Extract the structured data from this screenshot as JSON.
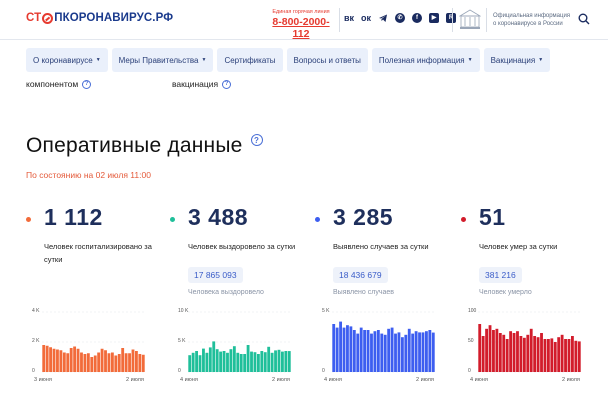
{
  "header": {
    "logo_part1": "СТ",
    "logo_part2": "ПКОРОНАВИРУС.РФ",
    "hotline_caption": "Единая горячая линия",
    "hotline_number": "8-800-2000-112",
    "socials": [
      "vk-icon",
      "ok-icon",
      "telegram-icon",
      "viber-icon",
      "fb-icon",
      "youtube-icon",
      "rutube-icon"
    ],
    "official_info": "Официальная информация о коронавирусе в России"
  },
  "nav": {
    "items": [
      {
        "label": "О коронавирусе",
        "dropdown": true
      },
      {
        "label": "Меры Правительства",
        "dropdown": true
      },
      {
        "label": "Сертификаты",
        "dropdown": false
      },
      {
        "label": "Вопросы и ответы",
        "dropdown": false
      },
      {
        "label": "Полезная информация",
        "dropdown": true
      },
      {
        "label": "Вакцинация",
        "dropdown": true
      }
    ]
  },
  "cut_text": {
    "left": "компонентом",
    "right": "вакцинация"
  },
  "main": {
    "title": "Оперативные данные",
    "subtitle": "По состоянию на 02 июля 11:00"
  },
  "stats": [
    {
      "value": "1 112",
      "label": "Человек госпитализировано за сутки",
      "total": "",
      "total_label": "",
      "color": "#f26b3a"
    },
    {
      "value": "3 488",
      "label": "Человек выздоровело за сутки",
      "total": "17 865 093",
      "total_label": "Человека выздоровело",
      "color": "#1fbf9a"
    },
    {
      "value": "3 285",
      "label": "Выявлено случаев за сутки",
      "total": "18 436 679",
      "total_label": "Выявлено случаев",
      "color": "#3d5ef0"
    },
    {
      "value": "51",
      "label": "Человек умер за сутки",
      "total": "381 216",
      "total_label": "Человек умерло",
      "color": "#d21c2b"
    }
  ],
  "chart_data": [
    {
      "type": "bar",
      "color": "#f26b3a",
      "x_start_label": "3 июня",
      "x_end_label": "2 июля",
      "ytick_labels": [
        "4 K",
        "2 K",
        "0"
      ],
      "ytick_values": [
        4000,
        2000,
        0
      ],
      "ylim": [
        0,
        4000
      ],
      "values": [
        1800,
        1750,
        1650,
        1550,
        1500,
        1450,
        1300,
        1250,
        1600,
        1700,
        1550,
        1300,
        1200,
        1250,
        1000,
        1100,
        1300,
        1550,
        1450,
        1250,
        1300,
        1100,
        1200,
        1600,
        1250,
        1250,
        1500,
        1400,
        1200,
        1150
      ]
    },
    {
      "type": "bar",
      "color": "#1fbf9a",
      "x_start_label": "4 июня",
      "x_end_label": "2 июля",
      "ytick_labels": [
        "10 K",
        "5 K",
        "0"
      ],
      "ytick_values": [
        10000,
        5000,
        0
      ],
      "ylim": [
        0,
        10000
      ],
      "values": [
        2800,
        3200,
        3500,
        2800,
        3900,
        3200,
        4100,
        5100,
        3800,
        3400,
        3500,
        3200,
        3800,
        4300,
        3200,
        3000,
        3000,
        4500,
        3400,
        3300,
        3000,
        3500,
        3300,
        4200,
        3200,
        3600,
        3700,
        3400,
        3500,
        3488
      ]
    },
    {
      "type": "bar",
      "color": "#3d5ef0",
      "x_start_label": "4 июня",
      "x_end_label": "2 июля",
      "ytick_labels": [
        "5 K",
        "0"
      ],
      "ytick_values": [
        5000,
        0
      ],
      "ylim": [
        0,
        5000
      ],
      "values": [
        4000,
        3700,
        4200,
        3700,
        3900,
        3800,
        3500,
        3200,
        3700,
        3500,
        3500,
        3200,
        3400,
        3500,
        3200,
        3100,
        3600,
        3700,
        3200,
        3300,
        2900,
        3100,
        3600,
        3200,
        3400,
        3300,
        3300,
        3400,
        3500,
        3285
      ]
    },
    {
      "type": "bar",
      "color": "#d21c2b",
      "x_start_label": "4 июня",
      "x_end_label": "2 июля",
      "ytick_labels": [
        "100",
        "50",
        "0"
      ],
      "ytick_values": [
        100,
        50,
        0
      ],
      "ylim": [
        0,
        100
      ],
      "values": [
        80,
        60,
        72,
        78,
        70,
        72,
        65,
        62,
        55,
        68,
        65,
        68,
        60,
        57,
        62,
        72,
        60,
        58,
        65,
        55,
        55,
        56,
        50,
        58,
        62,
        55,
        55,
        60,
        52,
        51
      ]
    }
  ]
}
